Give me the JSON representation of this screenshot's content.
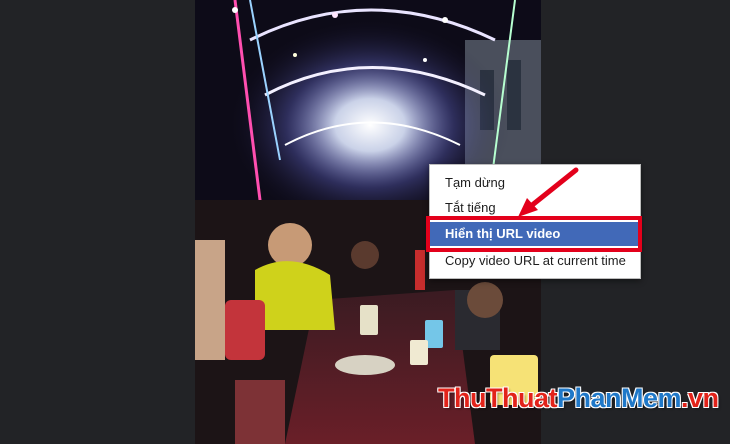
{
  "context_menu": {
    "items": [
      {
        "label": "Tạm dừng"
      },
      {
        "label": "Tắt tiếng"
      },
      {
        "label": "Hiển thị URL video"
      },
      {
        "label": "Copy video URL at current time"
      }
    ]
  },
  "watermark": {
    "part1": "ThuThuat",
    "part2": "PhanMem",
    "part3": ".vn"
  },
  "colors": {
    "highlight_bg": "#4169b8",
    "annotation_red": "#e3001b",
    "watermark_red": "#e2231a",
    "watermark_blue": "#1f78c8"
  }
}
